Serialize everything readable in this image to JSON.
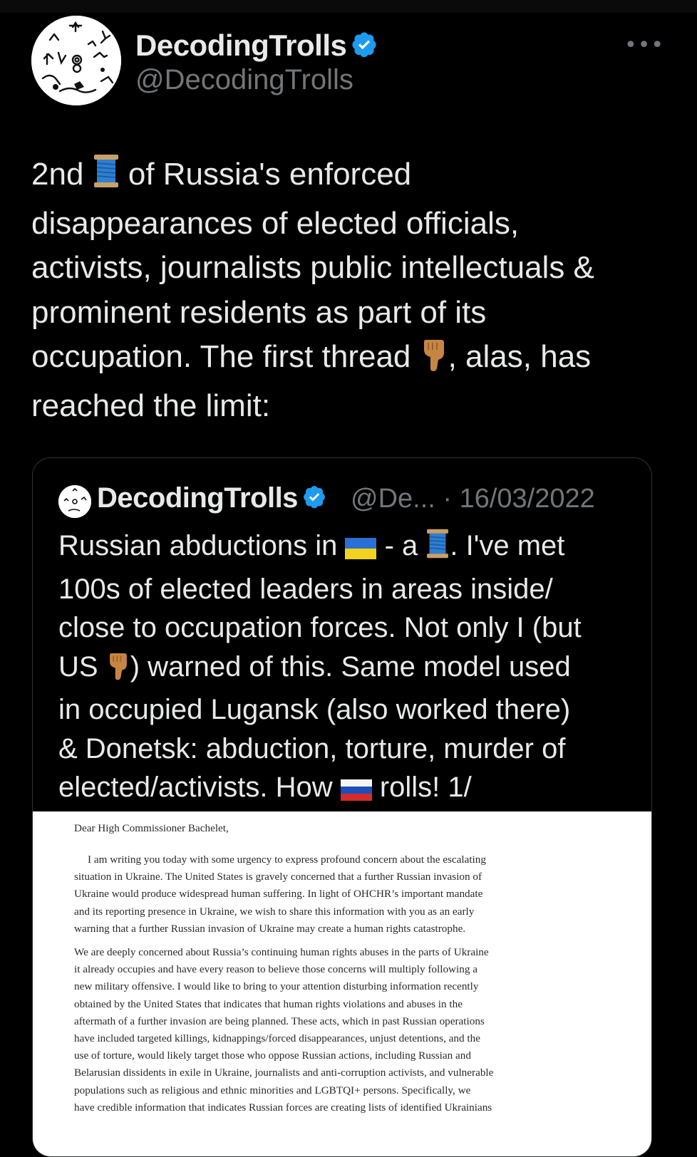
{
  "tweet": {
    "author_name": "DecodingTrolls",
    "author_handle": "@DecodingTrolls",
    "more_icon": "•••",
    "text_lines": [
      [
        "2nd ",
        "spool-emoji",
        " of Russia's enforced"
      ],
      [
        "disappearances of elected officials,"
      ],
      [
        "activists, journalists public intellectuals &"
      ],
      [
        "prominent residents as part of its"
      ],
      [
        "occupation. The first thread ",
        "pointing-down-emoji",
        ", alas, has"
      ],
      [
        "reached the limit:"
      ]
    ]
  },
  "quote": {
    "author_name": "DecodingTrolls",
    "author_handle_date": "@De... · 16/03/2022",
    "text_lines": [
      "Russian abductions in ",
      " - a ",
      ". I've met",
      "100s of elected leaders in areas inside/",
      "close to occupation forces. Not only I (but",
      "US ",
      ") warned of this. Same model used",
      "in occupied Lugansk (also worked there)",
      "& Donetsk: abduction, torture, murder of",
      "elected/activists. How ",
      " rolls! 1/"
    ]
  },
  "document": {
    "salutation": "Dear High Commissioner Bachelet,",
    "paragraph1": [
      "     I am writing you today with some urgency to express profound concern about the escalating",
      "situation in Ukraine.  The United States is gravely concerned that a further Russian invasion of",
      "Ukraine would produce widespread human suffering. In light of OHCHR’s important mandate",
      "and its reporting presence in Ukraine, we wish to share this information with you as an early",
      "warning that a further Russian invasion of Ukraine may create a human rights catastrophe."
    ],
    "paragraph2": [
      "We are deeply concerned about Russia’s continuing human rights abuses in the parts of Ukraine",
      "it already occupies and have every reason to believe those concerns will multiply following a",
      "new military offensive.  I would like to bring to your attention disturbing information recently",
      "obtained by the United States that indicates that human rights violations and abuses in the",
      "aftermath of a further invasion are being planned.  These acts, which in past Russian operations",
      "have included targeted killings, kidnappings/forced disappearances, unjust detentions, and the",
      "use of torture, would likely target those who oppose Russian actions, including Russian and",
      "Belarusian dissidents in exile in Ukraine, journalists and anti-corruption activists, and vulnerable",
      "populations such as religious and ethnic minorities and LGBTQI+ persons.  Specifically, we",
      "have credible information that indicates Russian forces are creating lists of identified Ukrainians"
    ]
  },
  "colors": {
    "background": "#000000",
    "text": "#e7e9ea",
    "secondary": "#71767b",
    "verified": "#1d9bf0",
    "border": "#2f3336"
  }
}
